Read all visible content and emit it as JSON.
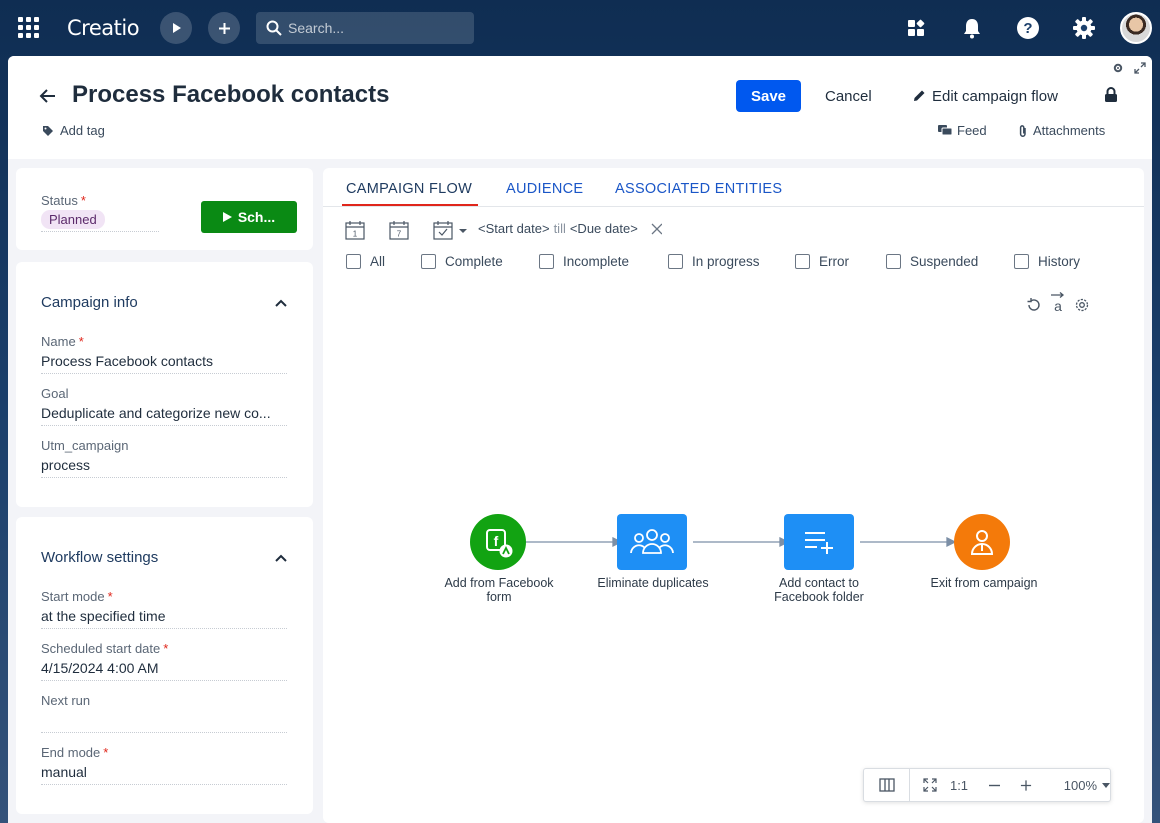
{
  "app": {
    "logo": "Creatio",
    "search_placeholder": "Search..."
  },
  "header": {
    "title": "Process Facebook contacts",
    "add_tag": "Add tag",
    "save": "Save",
    "cancel": "Cancel",
    "edit_flow": "Edit campaign flow",
    "feed": "Feed",
    "attachments": "Attachments"
  },
  "status_card": {
    "label": "Status",
    "value": "Planned",
    "schedule_button": "Sch..."
  },
  "campaign_info": {
    "title": "Campaign info",
    "fields": [
      {
        "label": "Name",
        "required": true,
        "value": "Process Facebook contacts"
      },
      {
        "label": "Goal",
        "required": false,
        "value": "Deduplicate and categorize new co..."
      },
      {
        "label": "Utm_campaign",
        "required": false,
        "value": "process"
      }
    ]
  },
  "workflow": {
    "title": "Workflow settings",
    "fields": [
      {
        "label": "Start mode",
        "required": true,
        "value": "at the specified time"
      },
      {
        "label": "Scheduled start date",
        "required": true,
        "value": "4/15/2024 4:00 AM"
      },
      {
        "label": "Next run",
        "required": false,
        "value": ""
      },
      {
        "label": "End mode",
        "required": true,
        "value": "manual"
      }
    ]
  },
  "tabs": [
    "CAMPAIGN FLOW",
    "AUDIENCE",
    "ASSOCIATED ENTITIES"
  ],
  "date_filter": {
    "cal1": "1",
    "cal7": "7",
    "start": "<Start date>",
    "till": "till",
    "due": "<Due date>"
  },
  "status_filters": [
    "All",
    "Complete",
    "Incomplete",
    "In progress",
    "Error",
    "Suspended",
    "History"
  ],
  "flow_nodes": [
    {
      "label": "Add from Facebook form",
      "color": "#12a312",
      "icon": "facebook-form-icon"
    },
    {
      "label": "Eliminate duplicates",
      "color": "#1e8ff5",
      "icon": "people-group-icon"
    },
    {
      "label": "Add contact to Facebook folder",
      "color": "#1e8ff5",
      "icon": "add-to-list-icon"
    },
    {
      "label": "Exit from campaign",
      "color": "#f47a0a",
      "icon": "exit-person-icon"
    }
  ],
  "zoom": {
    "ratio": "1:1",
    "level": "100%"
  },
  "colors": {
    "primary": "#0058ef",
    "schedule": "#0a8a14",
    "tab_accent": "#e0261b",
    "link": "#1a56c7"
  }
}
